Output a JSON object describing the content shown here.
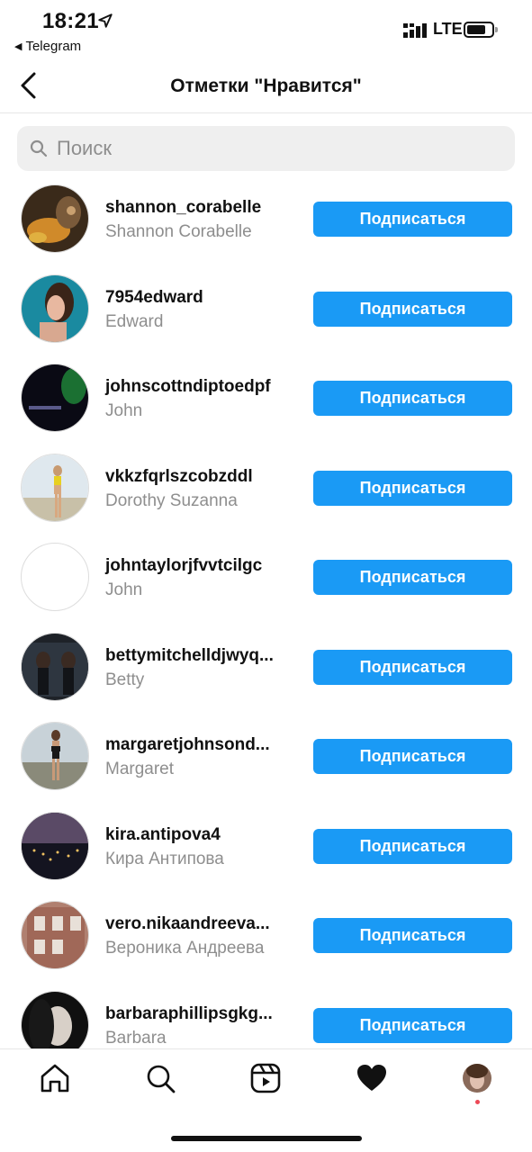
{
  "status_bar": {
    "time": "18:21",
    "back_app": "Telegram",
    "network": "LTE"
  },
  "header": {
    "title": "Отметки \"Нравится\"",
    "back_icon": "chevron-left-icon"
  },
  "search": {
    "placeholder": "Поиск",
    "value": ""
  },
  "users": [
    {
      "username": "shannon_corabelle",
      "full_name": "Shannon Corabelle",
      "button": "Подписаться"
    },
    {
      "username": "7954edward",
      "full_name": "Edward",
      "button": "Подписаться"
    },
    {
      "username": "johnscottndiptoedpf",
      "full_name": "John",
      "button": "Подписаться"
    },
    {
      "username": "vkkzfqrlszcobzddl",
      "full_name": "Dorothy Suzanna",
      "button": "Подписаться"
    },
    {
      "username": "johntaylorjfvvtcilgc",
      "full_name": "John",
      "button": "Подписаться"
    },
    {
      "username": "bettymitchelldjwyq...",
      "full_name": "Betty",
      "button": "Подписаться"
    },
    {
      "username": "margaretjohnsond...",
      "full_name": "Margaret",
      "button": "Подписаться"
    },
    {
      "username": "kira.antipova4",
      "full_name": "Кира Антипова",
      "button": "Подписаться"
    },
    {
      "username": "vero.nikaandreeva...",
      "full_name": "Вероника Андреева",
      "button": "Подписаться"
    },
    {
      "username": "barbaraphillipsgkg...",
      "full_name": "Barbara",
      "button": "Подписаться"
    }
  ],
  "tab_bar": {
    "items": [
      "home-icon",
      "search-icon",
      "reels-icon",
      "heart-icon",
      "profile-avatar"
    ],
    "active": "heart-icon"
  },
  "colors": {
    "accent": "#1a9af5",
    "secondary_text": "#8e8e8e",
    "search_bg": "#efefef",
    "notification": "#ed4956"
  }
}
